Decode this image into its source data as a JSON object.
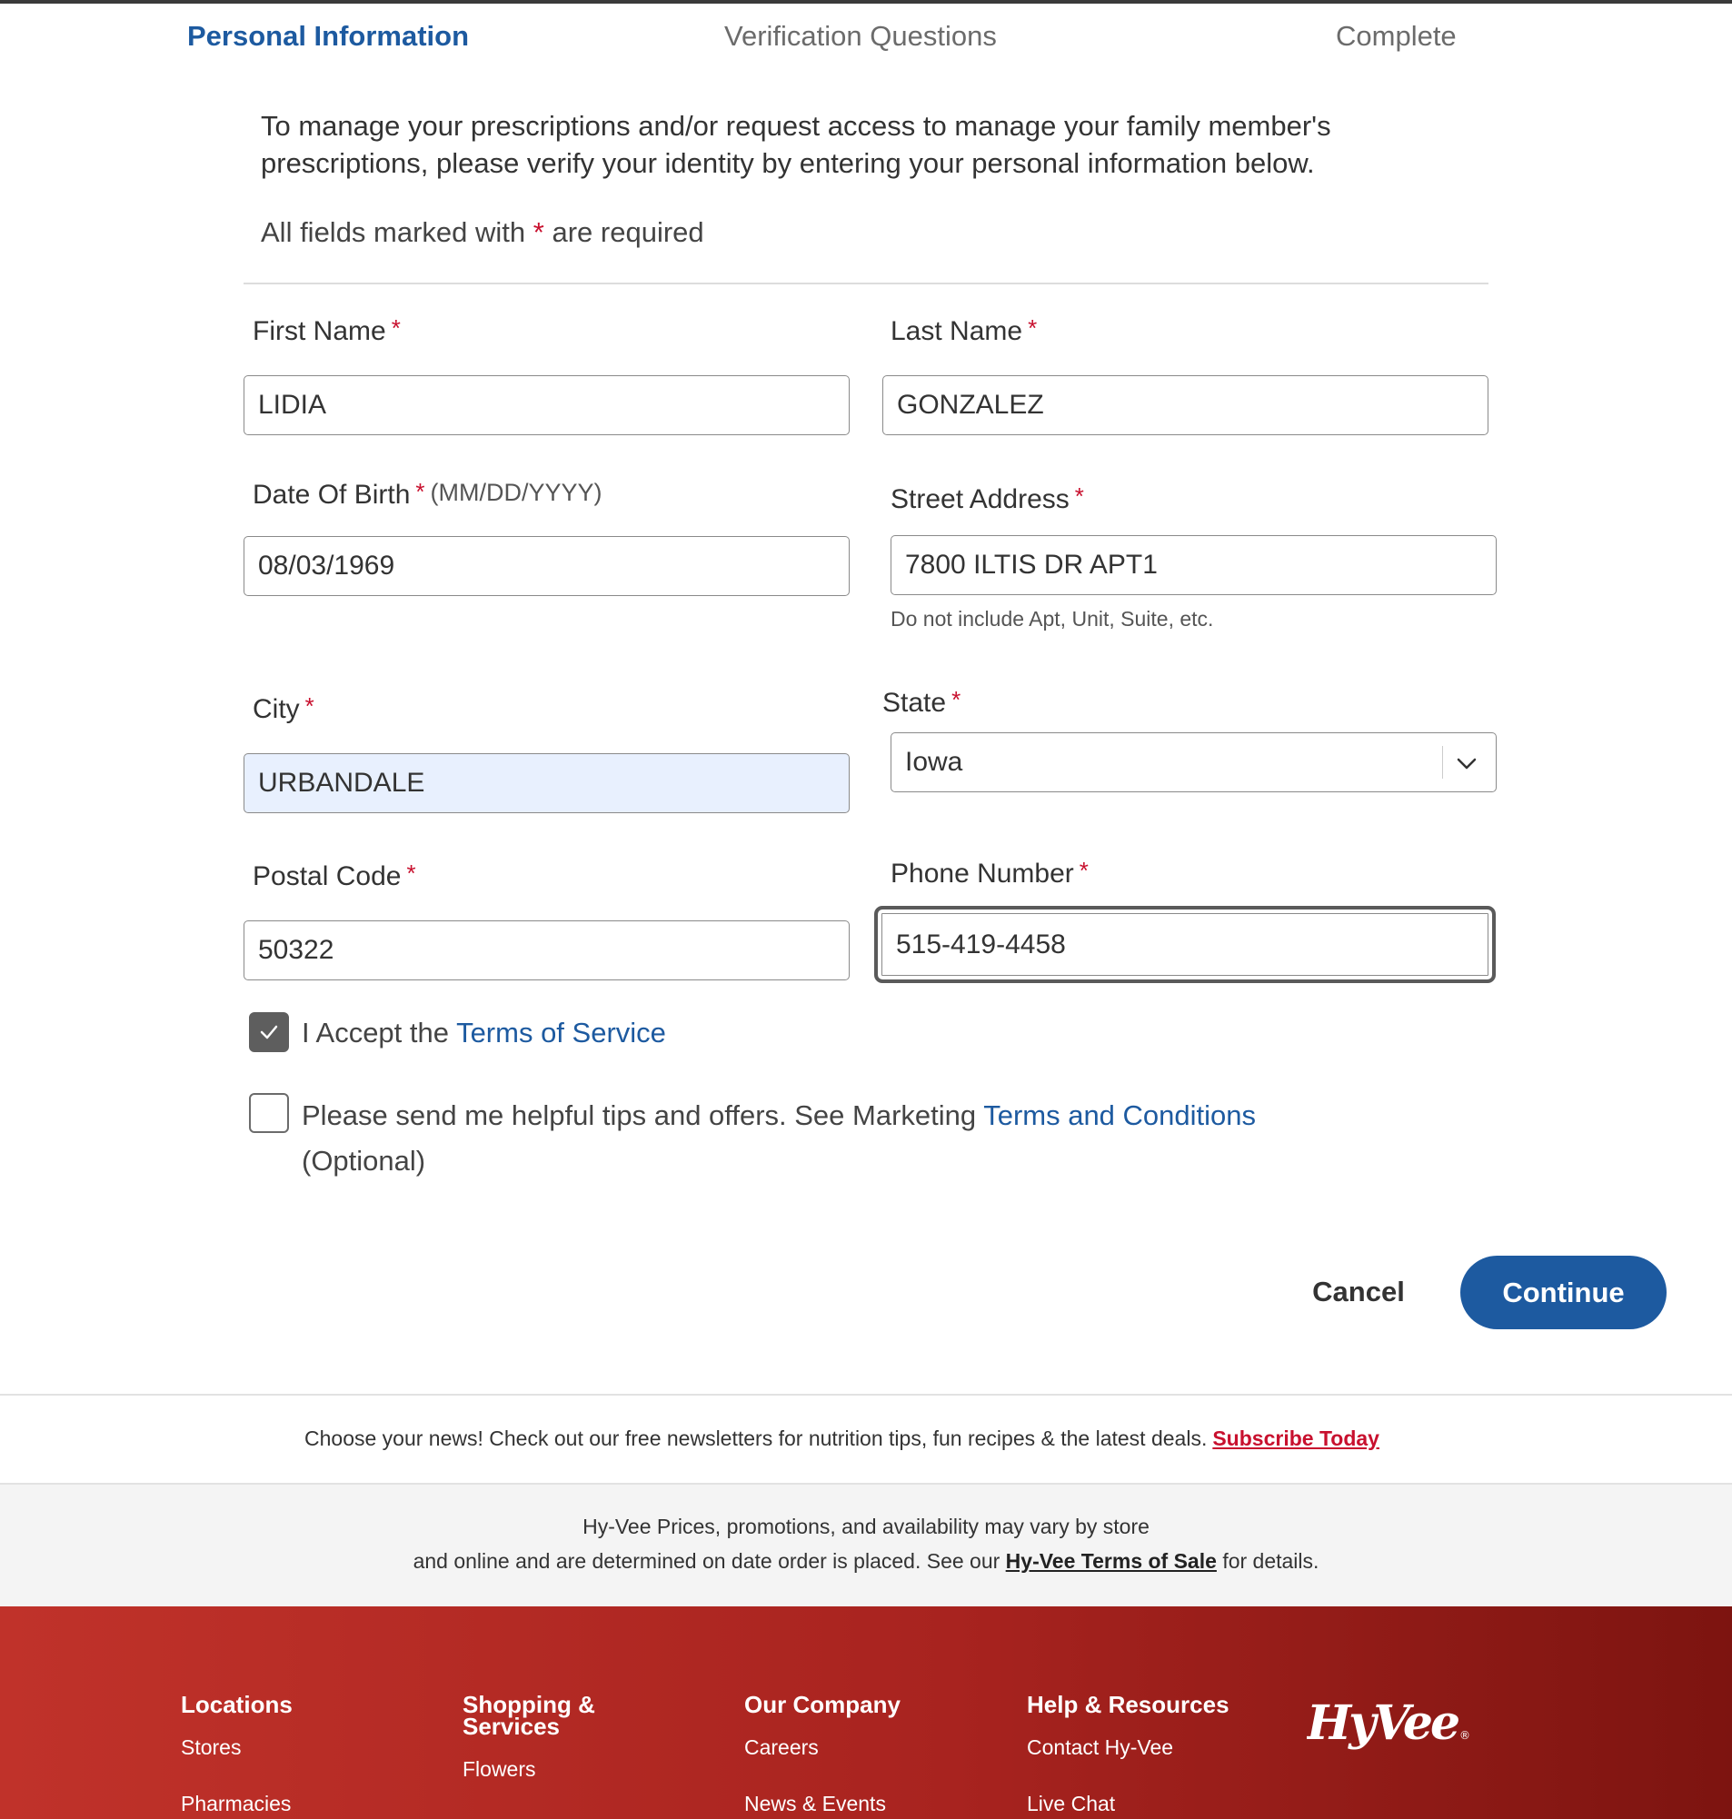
{
  "steps": {
    "personal": "Personal Information",
    "verification": "Verification Questions",
    "complete": "Complete"
  },
  "intro": "To manage your prescriptions and/or request access to manage your family member's prescriptions, please verify your identity by entering your personal information below.",
  "required_note": {
    "prefix": "All fields marked with",
    "star": "*",
    "suffix": "are required"
  },
  "form": {
    "first_name": {
      "label": "First Name",
      "value": "LIDIA"
    },
    "last_name": {
      "label": "Last Name",
      "value": "GONZALEZ"
    },
    "dob": {
      "label": "Date Of Birth",
      "hint": "(MM/DD/YYYY)",
      "value": "08/03/1969"
    },
    "street": {
      "label": "Street Address",
      "value": "7800 ILTIS DR APT1",
      "helper": "Do not include Apt, Unit, Suite, etc."
    },
    "city": {
      "label": "City",
      "value": "URBANDALE"
    },
    "state": {
      "label": "State",
      "value": "Iowa"
    },
    "postal": {
      "label": "Postal Code",
      "value": "50322"
    },
    "phone": {
      "label": "Phone Number",
      "value": "515-419-4458"
    }
  },
  "terms": {
    "checked": true,
    "text": "I Accept the",
    "link": "Terms of Service"
  },
  "marketing": {
    "checked": false,
    "text": "Please send me helpful tips and offers. See Marketing",
    "link": "Terms and Conditions",
    "optional": "(Optional)"
  },
  "buttons": {
    "cancel": "Cancel",
    "continue": "Continue"
  },
  "newsletter": {
    "text": "Choose your news! Check out our free newsletters for nutrition tips, fun recipes & the latest deals.",
    "link": "Subscribe Today"
  },
  "disclaimer": {
    "line1": "Hy-Vee Prices, promotions, and availability may vary by store",
    "line2_prefix": "and online and are determined on date order is placed. See our",
    "link": "Hy-Vee Terms of Sale",
    "line2_suffix": "for details."
  },
  "footer": {
    "columns": [
      {
        "heading": "Locations",
        "items": [
          "Stores",
          "Pharmacies"
        ]
      },
      {
        "heading_line1": "Shopping &",
        "heading_line2": "Services",
        "items": [
          "Flowers"
        ]
      },
      {
        "heading": "Our Company",
        "items": [
          "Careers",
          "News & Events"
        ]
      },
      {
        "heading": "Help & Resources",
        "items": [
          "Contact Hy-Vee",
          "Live Chat"
        ]
      }
    ],
    "logo_text": "HyVee",
    "logo_mark": "®"
  },
  "colors": {
    "brand_blue": "#1d5aa0",
    "required_red": "#c8102e",
    "footer_red": "#a8231f",
    "autofill": "#e8f0fe"
  }
}
